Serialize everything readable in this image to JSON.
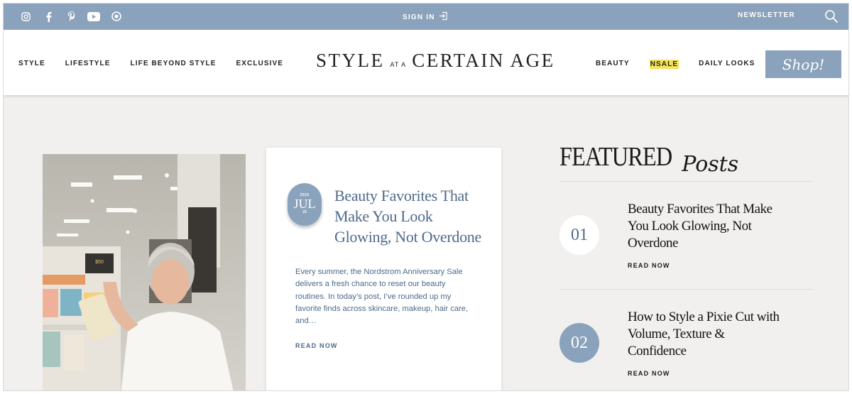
{
  "topbar": {
    "social_icons": [
      "instagram-icon",
      "facebook-icon",
      "pinterest-icon",
      "youtube-icon",
      "ltk-icon"
    ],
    "signin_label": "SIGN IN",
    "newsletter_label": "NEWSLETTER",
    "search_icon": "search-icon",
    "bg_color": "#8aa2bb"
  },
  "nav": {
    "left": [
      "STYLE",
      "LIFESTYLE",
      "LIFE BEYOND STYLE",
      "EXCLUSIVE"
    ],
    "logo": {
      "part1": "STYLE",
      "part2": "AT A",
      "part3": "CERTAIN AGE"
    },
    "right": [
      "BEAUTY",
      "NSALE",
      "DAILY LOOKS"
    ],
    "shop_label": "Shop!"
  },
  "hero": {
    "date": {
      "year": "2025",
      "month": "JUL",
      "day": "23"
    },
    "title": "Beauty Favorites That Make You Look Glowing, Not Overdone",
    "excerpt": "Every summer, the Nordstrom Anniversary Sale delivers a fresh chance to reset our beauty routines. In today’s post, I’ve rounded up my favorite finds across skincare, makeup, hair care, and…",
    "read_label": "READ NOW"
  },
  "featured": {
    "heading": "FEATURED",
    "heading_script": "Posts",
    "items": [
      {
        "number": "01",
        "title": "Beauty Favorites That Make You Look Glowing, Not Overdone",
        "read_label": "READ NOW"
      },
      {
        "number": "02",
        "title": "How to Style a Pixie Cut with Volume, Texture & Confidence",
        "read_label": "READ NOW"
      }
    ]
  },
  "colors": {
    "accent": "#8aa2bb",
    "title_blue": "#4e6a8a",
    "highlight": "#f3e35a",
    "background": "#f1f0ee"
  }
}
